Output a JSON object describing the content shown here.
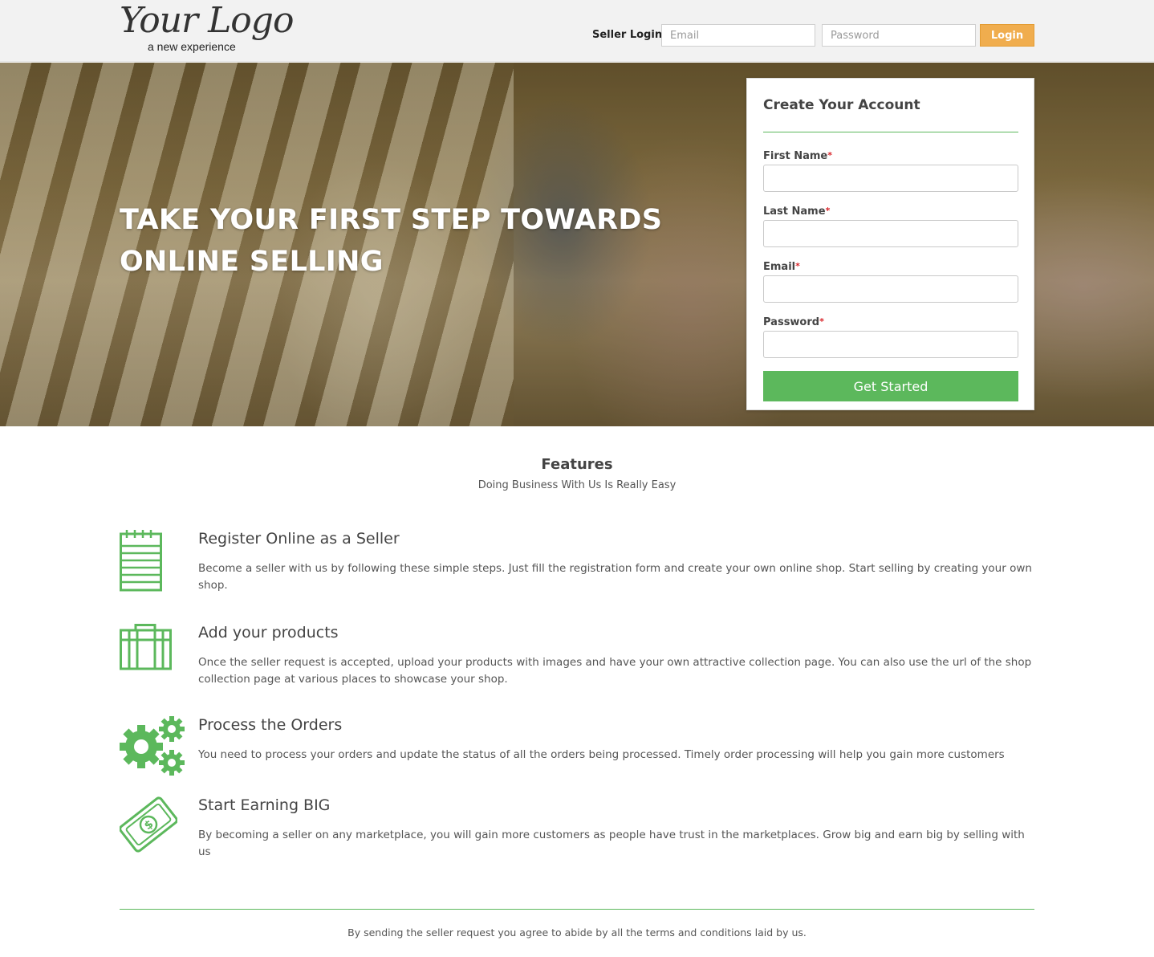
{
  "header": {
    "logo_text": "Your Logo",
    "logo_tagline": "a new experience",
    "seller_login_label": "Seller Login",
    "email_placeholder": "Email",
    "password_placeholder": "Password",
    "login_button": "Login"
  },
  "hero": {
    "headline_line1": "TAKE YOUR FIRST STEP TOWARDS",
    "headline_line2": "ONLINE SELLING"
  },
  "signup": {
    "title": "Create Your Account",
    "fields": [
      {
        "label": "First Name",
        "required_mark": "*"
      },
      {
        "label": "Last Name",
        "required_mark": "*"
      },
      {
        "label": "Email",
        "required_mark": "*"
      },
      {
        "label": "Password",
        "required_mark": "*"
      }
    ],
    "submit_button": "Get Started"
  },
  "features": {
    "title": "Features",
    "subtitle": "Doing Business With Us Is Really Easy",
    "items": [
      {
        "icon": "notepad-icon",
        "title": "Register Online as a Seller",
        "description": "Become a seller with us by following these simple steps. Just fill the registration form and create your own online shop. Start selling by creating your own shop."
      },
      {
        "icon": "shopping-bag-icon",
        "title": "Add your products",
        "description": "Once the seller request is accepted, upload your products with images and have your own attractive collection page. You can also use the url of the shop collection page at various places to showcase your shop."
      },
      {
        "icon": "gears-icon",
        "title": "Process the Orders",
        "description": "You need to process your orders and update the status of all the orders being processed. Timely order processing will help you gain more customers"
      },
      {
        "icon": "money-bill-icon",
        "title": "Start Earning BIG",
        "description": "By becoming a seller on any marketplace, you will gain more customers as people have trust in the marketplaces. Grow big and earn big by selling with us"
      }
    ]
  },
  "footer": {
    "terms_text": "By sending the seller request you agree to abide by all the terms and conditions laid by us."
  },
  "colors": {
    "accent_green": "#5cb85c",
    "login_orange": "#f0ad4e",
    "required_red": "#d9262b"
  }
}
